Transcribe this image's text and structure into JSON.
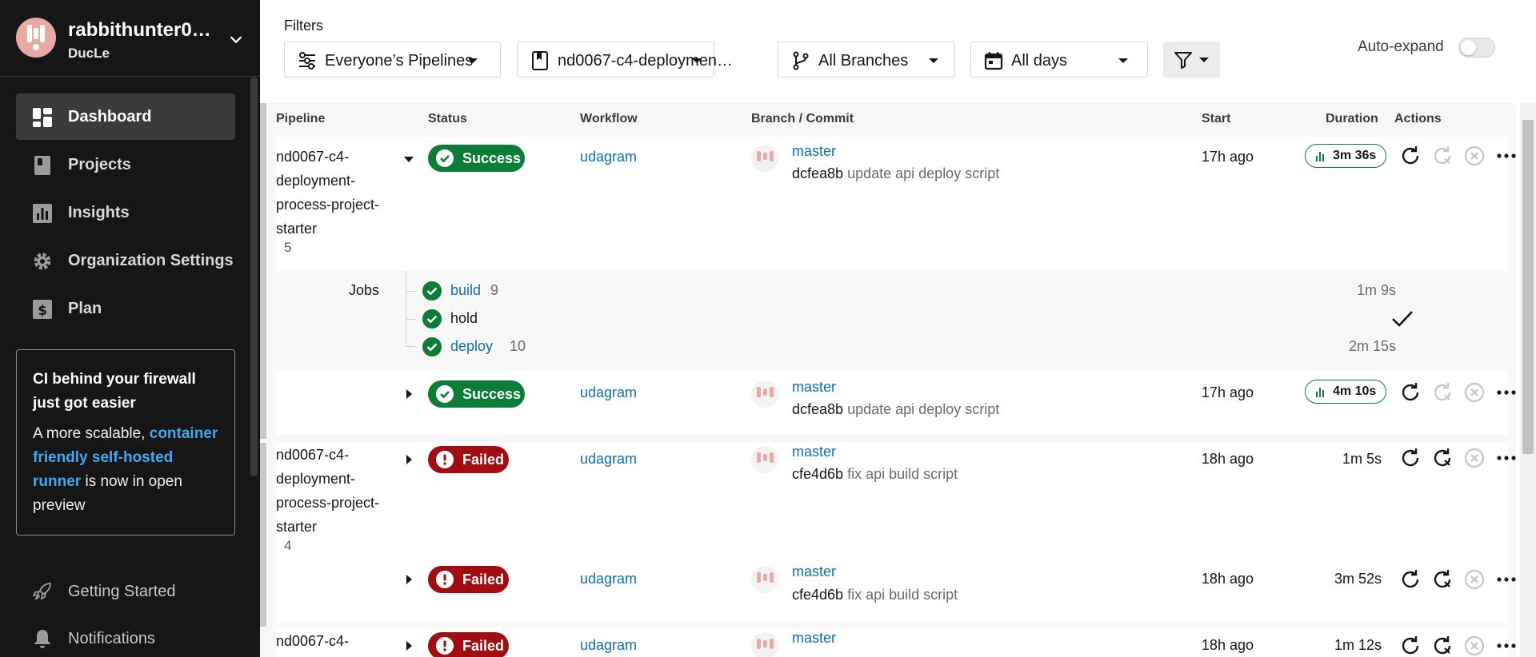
{
  "sidebar": {
    "org_name": "rabbithunter0…",
    "username": "DucLe",
    "nav": [
      {
        "label": "Dashboard",
        "icon": "dashboard-icon",
        "active": true
      },
      {
        "label": "Projects",
        "icon": "projects-icon"
      },
      {
        "label": "Insights",
        "icon": "insights-icon"
      },
      {
        "label": "Organization Settings",
        "icon": "gear-icon"
      },
      {
        "label": "Plan",
        "icon": "plan-icon"
      }
    ],
    "promo": {
      "title": "CI behind your firewall just got easier",
      "body_prefix": "A more scalable,",
      "link": "container friendly self-hosted runner",
      "body_suffix": "is now in open preview"
    },
    "bottom": [
      {
        "label": "Getting Started",
        "icon": "rocket-icon"
      },
      {
        "label": "Notifications",
        "icon": "bell-icon"
      }
    ]
  },
  "filters": {
    "title": "Filters",
    "pipelines": "Everyone’s Pipelines",
    "project": "nd0067-c4-deploymen…",
    "branches": "All Branches",
    "days": "All days",
    "auto_expand_label": "Auto-expand",
    "auto_expand_on": false
  },
  "table": {
    "headers": {
      "pipeline": "Pipeline",
      "status": "Status",
      "workflow": "Workflow",
      "branch_commit": "Branch / Commit",
      "start": "Start",
      "duration": "Duration",
      "actions": "Actions"
    },
    "groups": [
      {
        "pipeline_lines": [
          "nd0067-c4-",
          "deployment-",
          "process-project-",
          "starter"
        ],
        "number": "5",
        "rows": [
          {
            "status": "Success",
            "workflow": "udagram",
            "branch": "master",
            "sha": "dcfea8b",
            "message": "update api deploy script",
            "start": "17h ago",
            "duration": "3m 36s"
          },
          {
            "status": "Success",
            "workflow": "udagram",
            "branch": "master",
            "sha": "dcfea8b",
            "message": "update api deploy script",
            "start": "17h ago",
            "duration": "4m 10s"
          }
        ],
        "jobs": {
          "label": "Jobs",
          "items": [
            {
              "name": "build",
              "number": "9",
              "duration": "1m 9s"
            },
            {
              "name": "hold",
              "number": "",
              "duration": ""
            },
            {
              "name": "deploy",
              "number": "10",
              "duration": "2m 15s"
            }
          ]
        }
      },
      {
        "pipeline_lines": [
          "nd0067-c4-",
          "deployment-",
          "process-project-",
          "starter"
        ],
        "number": "4",
        "rows": [
          {
            "status": "Failed",
            "workflow": "udagram",
            "branch": "master",
            "sha": "cfe4d6b",
            "message": "fix api build script",
            "start": "18h ago",
            "duration": "1m 5s"
          },
          {
            "status": "Failed",
            "workflow": "udagram",
            "branch": "master",
            "sha": "cfe4d6b",
            "message": "fix api build script",
            "start": "18h ago",
            "duration": "3m 52s"
          }
        ]
      },
      {
        "pipeline_lines": [
          "nd0067-c4-"
        ],
        "rows": [
          {
            "status": "Failed",
            "workflow": "udagram",
            "branch": "master",
            "start": "18h ago",
            "duration": "1m 12s"
          }
        ]
      }
    ]
  },
  "colors": {
    "sidebar_bg": "#161616",
    "success": "#0a7d36",
    "failed": "#a30d11",
    "link": "#0f6fb0"
  }
}
